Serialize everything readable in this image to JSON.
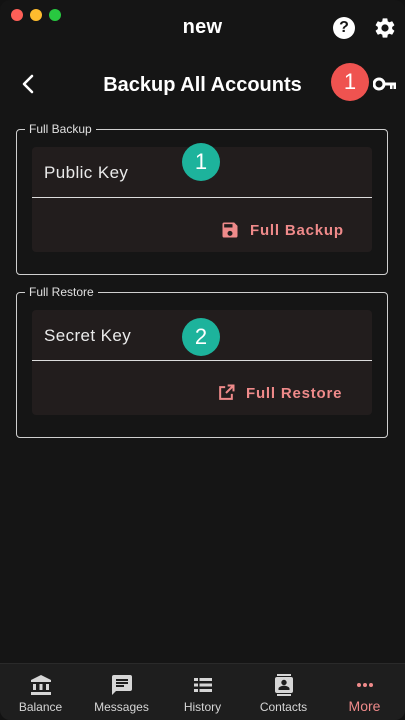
{
  "window": {
    "title": "new"
  },
  "header": {
    "title": "Backup All Accounts",
    "badge": "1"
  },
  "full_backup": {
    "legend": "Full Backup",
    "field_label": "Public Key",
    "badge": "1",
    "action_label": "Full Backup"
  },
  "full_restore": {
    "legend": "Full Restore",
    "field_label": "Secret Key",
    "badge": "2",
    "action_label": "Full Restore"
  },
  "bottom_nav": {
    "items": [
      {
        "label": "Balance",
        "icon": "bank-icon"
      },
      {
        "label": "Messages",
        "icon": "message-icon"
      },
      {
        "label": "History",
        "icon": "list-icon"
      },
      {
        "label": "Contacts",
        "icon": "contacts-icon"
      },
      {
        "label": "More",
        "icon": "more-icon"
      }
    ],
    "active": "More"
  },
  "colors": {
    "accent": "#ef8a8a",
    "badge_red": "#ef5350",
    "badge_teal": "#1db39c",
    "background": "#151515"
  }
}
